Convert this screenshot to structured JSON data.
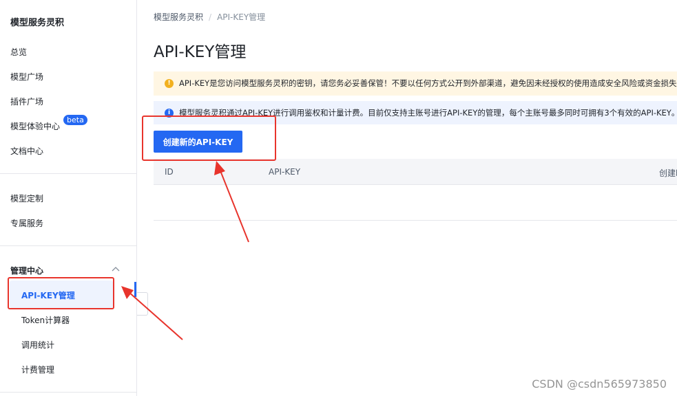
{
  "sidebar": {
    "brand": "模型服务灵积",
    "items": [
      {
        "label": "总览"
      },
      {
        "label": "模型广场"
      },
      {
        "label": "插件广场"
      },
      {
        "label": "模型体验中心",
        "badge": "beta"
      },
      {
        "label": "文档中心"
      }
    ],
    "items2": [
      {
        "label": "模型定制"
      },
      {
        "label": "专属服务"
      }
    ],
    "group": {
      "title": "管理中心",
      "items": [
        {
          "label": "API-KEY管理",
          "active": true
        },
        {
          "label": "Token计算器"
        },
        {
          "label": "调用统计"
        },
        {
          "label": "计费管理"
        }
      ]
    }
  },
  "breadcrumb": {
    "root": "模型服务灵积",
    "separator": "/",
    "current": "API-KEY管理"
  },
  "page": {
    "title": "API-KEY管理",
    "warning_text": "API-KEY是您访问模型服务灵积的密钥，请您务必妥善保管！不要以任何方式公开到外部渠道，避免因未经授权的使用造成安全风险或资金损失。",
    "info_text": "模型服务灵积通过API-KEY进行调用鉴权和计量计费。目前仅支持主账号进行API-KEY的管理，每个主账号最多同时可拥有3个有效的API-KEY。",
    "create_button": "创建新的API-KEY",
    "table": {
      "columns": [
        "ID",
        "API-KEY",
        "创建时间"
      ]
    }
  },
  "watermark": "CSDN @csdn565973850",
  "colors": {
    "accent": "#2468f2",
    "annotation": "#e8342c",
    "warning_bg": "#fff6e3",
    "info_bg": "#eef3fe"
  }
}
